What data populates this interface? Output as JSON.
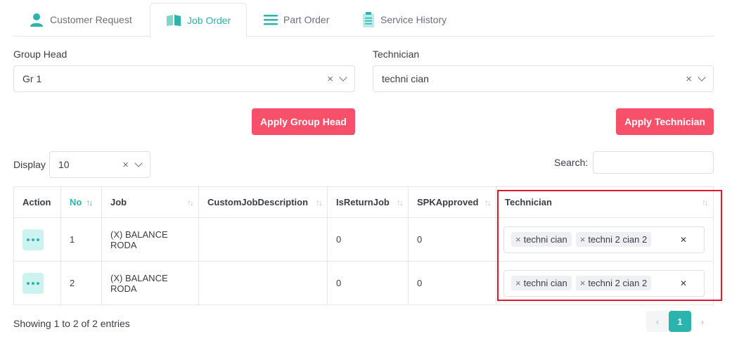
{
  "tabs": [
    {
      "label": "Customer Request",
      "icon": "user-icon"
    },
    {
      "label": "Job Order",
      "icon": "book-icon",
      "active": true
    },
    {
      "label": "Part Order",
      "icon": "list-icon"
    },
    {
      "label": "Service History",
      "icon": "clipboard-icon"
    }
  ],
  "group_head": {
    "label": "Group Head",
    "value": "Gr 1",
    "button": "Apply Group Head"
  },
  "technician": {
    "label": "Technician",
    "value": "techni cian",
    "button": "Apply Technician"
  },
  "display": {
    "label": "Display",
    "value": "10"
  },
  "search": {
    "label": "Search:",
    "value": ""
  },
  "table": {
    "headers": [
      "Action",
      "No",
      "Job",
      "CustomJobDescription",
      "IsReturnJob",
      "SPKApproved",
      "Technician"
    ],
    "rows": [
      {
        "no": "1",
        "job": "(X) BALANCE RODA",
        "custom": "",
        "is_return": "0",
        "spk": "0",
        "technicians": [
          "techni cian",
          "techni 2 cian 2"
        ]
      },
      {
        "no": "2",
        "job": "(X) BALANCE RODA",
        "custom": "",
        "is_return": "0",
        "spk": "0",
        "technicians": [
          "techni cian",
          "techni 2 cian 2"
        ]
      }
    ]
  },
  "footer": {
    "info": "Showing 1 to 2 of 2 entries",
    "page": "1",
    "prev": "‹",
    "next": "›"
  },
  "colors": {
    "accent": "#2bb3ad",
    "button": "#f6506a",
    "highlight": "#e0182d"
  }
}
